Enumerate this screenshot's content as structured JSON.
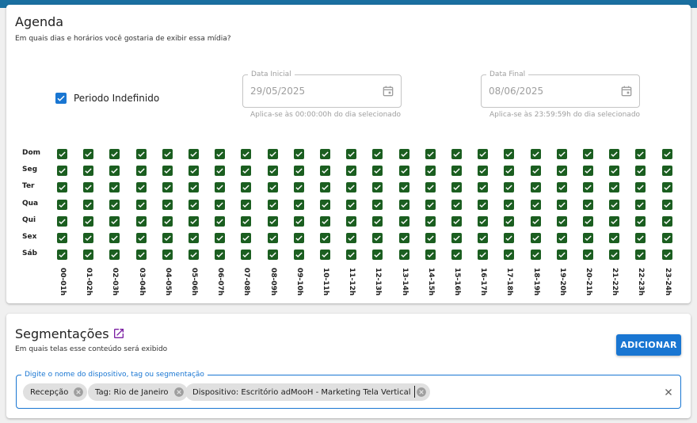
{
  "agenda": {
    "title": "Agenda",
    "subtitle": "Em quais dias e horários você gostaria de exibir essa mídia?",
    "periodo_label": "Periodo Indefinido",
    "periodo_checked": true,
    "start_date": {
      "legend": "Data Inicial",
      "value": "29/05/2025",
      "helper": "Aplica-se às 00:00:00h do dia selecionado",
      "icon": "calendar-icon"
    },
    "end_date": {
      "legend": "Data Final",
      "value": "08/06/2025",
      "helper": "Aplica-se às 23:59:59h do dia selecionado",
      "icon": "calendar-icon"
    },
    "days": [
      "Dom",
      "Seg",
      "Ter",
      "Qua",
      "Qui",
      "Sex",
      "Sáb"
    ],
    "hours": [
      "00-01h",
      "01-02h",
      "02-03h",
      "03-04h",
      "04-05h",
      "05-06h",
      "06-07h",
      "07-08h",
      "08-09h",
      "09-10h",
      "10-11h",
      "11-12h",
      "12-13h",
      "13-14h",
      "14-15h",
      "15-16h",
      "16-17h",
      "17-18h",
      "18-19h",
      "19-20h",
      "20-21h",
      "21-22h",
      "22-23h",
      "23-24h"
    ],
    "all_checked": true,
    "grid_color": "#1b5e20"
  },
  "segmentacoes": {
    "title": "Segmentações",
    "subtitle": "Em quais telas esse conteúdo será exibido",
    "add_button": "ADICIONAR",
    "search_legend": "Digite o nome do dispositivo, tag ou segmentação",
    "chips": [
      {
        "label": "Recepção"
      },
      {
        "label": "Tag: Rio de Janeiro"
      },
      {
        "label": "Dispositivo: Escritório adMooH - Marketing Tela Vertical"
      }
    ]
  },
  "colors": {
    "primary": "#1976d2",
    "topbar": "#1a6fa0",
    "link_icon": "#7b1fa2"
  }
}
